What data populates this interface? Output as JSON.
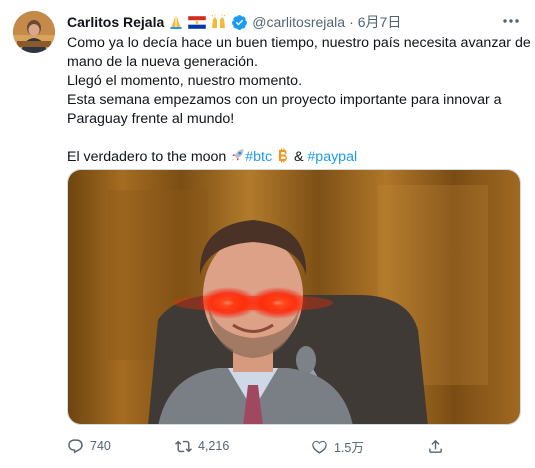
{
  "tweet": {
    "author_name": "Carlitos Rejala",
    "handle": "@carlitosrejala",
    "separator": "·",
    "date": "6月7日",
    "name_emojis": [
      "folded-hands-emoji",
      "paraguay-flag-emoji",
      "raised-hands-emoji"
    ],
    "verified": true,
    "text_lines": [
      "Como ya lo decía hace un buen tiempo, nuestro país necesita avanzar de la",
      "mano de la nueva generación.",
      "Llegó el momento, nuestro momento.",
      "Esta semana empezamos con un proyecto importante para innovar a",
      "Paraguay frente al mundo!"
    ],
    "closing": {
      "text": "El verdadero to the moon",
      "hashtag_btc": "#btc",
      "ampersand": "&",
      "hashtag_paypal": "#paypal"
    },
    "media": {
      "description_icons": [
        "laser-eyes",
        "wood-panel-background"
      ]
    },
    "actions": {
      "replies": "740",
      "retweets": "4,216",
      "likes": "1.5万"
    }
  },
  "colors": {
    "accent": "#1d9bf0",
    "secondary_text": "#536471",
    "laser_red": "#ff2a00"
  }
}
